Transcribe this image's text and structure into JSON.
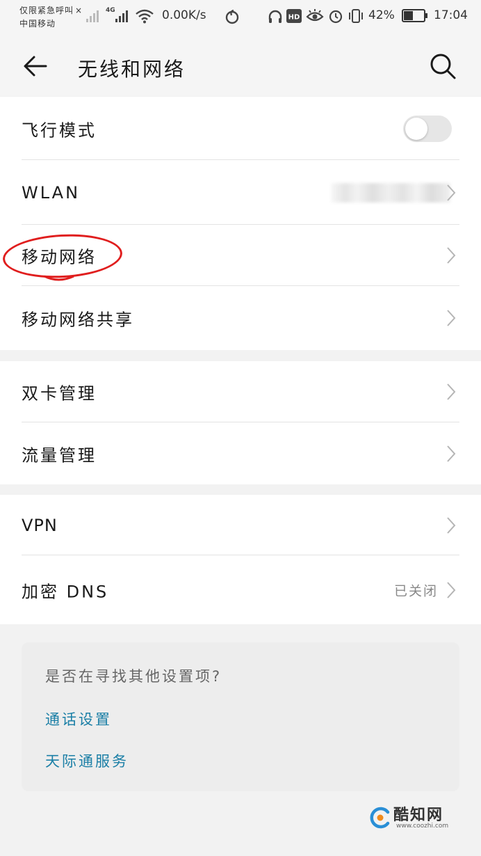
{
  "status_bar": {
    "emergency_text": "仅限紧急呼叫",
    "carrier": "中国移动",
    "network_tag": "4G",
    "speed": "0.00K/s",
    "battery": "42%",
    "battery_level": 0.42,
    "time": "17:04"
  },
  "header": {
    "title": "无线和网络"
  },
  "groups": [
    {
      "items": [
        {
          "label": "飞行模式",
          "control": "toggle",
          "toggle_on": false
        },
        {
          "label": "WLAN",
          "control": "chevron",
          "value": ""
        },
        {
          "label": "移动网络",
          "control": "chevron",
          "highlighted": true
        },
        {
          "label": "移动网络共享",
          "control": "chevron"
        }
      ]
    },
    {
      "items": [
        {
          "label": "双卡管理",
          "control": "chevron"
        },
        {
          "label": "流量管理",
          "control": "chevron"
        }
      ]
    },
    {
      "items": [
        {
          "label": "VPN",
          "control": "chevron"
        },
        {
          "label": "加密 DNS",
          "control": "chevron",
          "value": "已关闭"
        }
      ]
    }
  ],
  "suggestions": {
    "question": "是否在寻找其他设置项?",
    "links": [
      "通话设置",
      "天际通服务"
    ]
  },
  "watermark": {
    "brand": "酷知网",
    "url": "www.coozhi.com"
  },
  "colors": {
    "page_bg": "#f2f2f2",
    "link": "#1b7fa6",
    "highlight_circle": "#e01e1e"
  }
}
